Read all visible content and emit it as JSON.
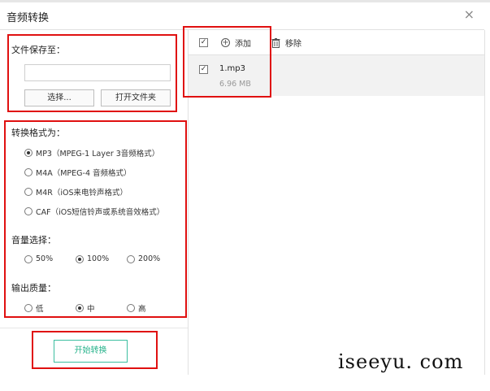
{
  "window": {
    "title": "音频转换",
    "close_glyph": "×"
  },
  "save": {
    "label": "文件保存至：",
    "path_value": "",
    "choose_label": "选择...",
    "open_folder_label": "打开文件夹"
  },
  "format": {
    "label": "转换格式为：",
    "options": [
      {
        "label": "MP3（MPEG-1 Layer 3音频格式）",
        "selected": true
      },
      {
        "label": "M4A（MPEG-4 音频格式）",
        "selected": false
      },
      {
        "label": "M4R（iOS来电铃声格式）",
        "selected": false
      },
      {
        "label": "CAF（iOS短信铃声或系统音效格式）",
        "selected": false
      }
    ]
  },
  "volume": {
    "label": "音量选择：",
    "options": [
      {
        "label": "50%",
        "selected": false
      },
      {
        "label": "100%",
        "selected": true
      },
      {
        "label": "200%",
        "selected": false
      }
    ]
  },
  "quality": {
    "label": "输出质量：",
    "options": [
      {
        "label": "低",
        "selected": false
      },
      {
        "label": "中",
        "selected": true
      },
      {
        "label": "高",
        "selected": false
      }
    ]
  },
  "start_label": "开始转换",
  "toolbar": {
    "add_label": "添加",
    "remove_label": "移除",
    "check_glyph": "✓"
  },
  "files": [
    {
      "name": "1.mp3",
      "size": "6.96 MB",
      "checked": true
    }
  ],
  "watermark": "iseeyu. com",
  "colors": {
    "accent": "#28b38c",
    "annotation_red": "#e01010"
  }
}
